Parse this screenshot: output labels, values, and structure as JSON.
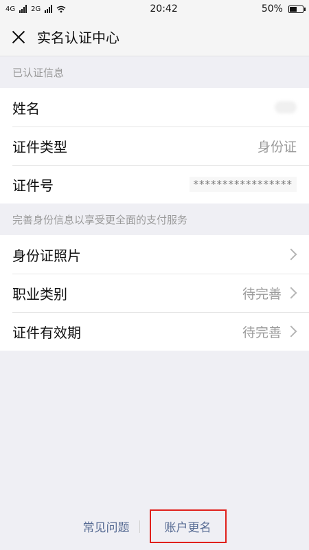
{
  "status_bar": {
    "network_left": "4G",
    "network_left2": "2G",
    "time": "20:42",
    "battery": "50%",
    "battery_level": 0.5
  },
  "navbar": {
    "title": "实名认证中心",
    "close_icon": "close-icon"
  },
  "verified_section": {
    "header": "已认证信息",
    "rows": [
      {
        "label": "姓名",
        "value": ""
      },
      {
        "label": "证件类型",
        "value": "身份证"
      },
      {
        "label": "证件号",
        "value": "*****************"
      }
    ]
  },
  "complete_section": {
    "header": "完善身份信息以享受更全面的支付服务",
    "rows": [
      {
        "label": "身份证照片",
        "value": ""
      },
      {
        "label": "职业类别",
        "value": "待完善"
      },
      {
        "label": "证件有效期",
        "value": "待完善"
      }
    ]
  },
  "footer": {
    "faq": "常见问题",
    "rename": "账户更名"
  },
  "colors": {
    "link": "#586c94",
    "highlight_border": "#e0201b",
    "background": "#efeff4"
  }
}
